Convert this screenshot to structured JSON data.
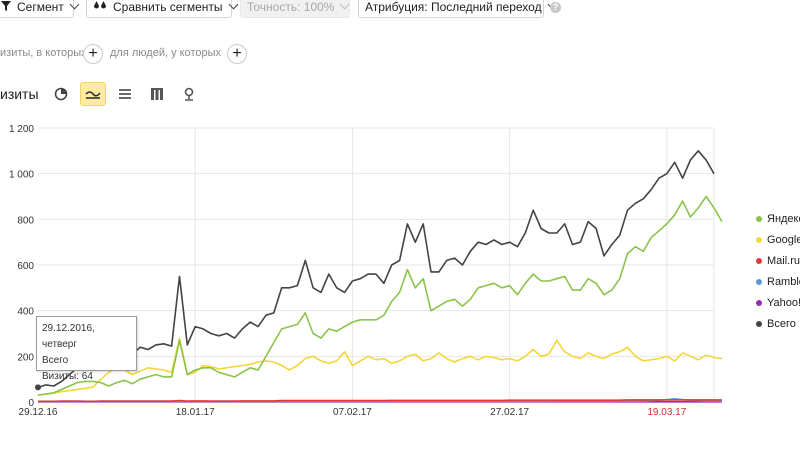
{
  "toolbar": {
    "segment_label": "Сегмент",
    "compare_label": "Сравнить сегменты",
    "accuracy_label": "Точность: 100%",
    "attribution_label": "Атрибуция: Последний переход",
    "help_glyph": "?"
  },
  "filters": {
    "visits_label": "изиты, в которых",
    "people_label": "для людей, у которых"
  },
  "metric_label": "изиты",
  "legend": [
    {
      "label": "Яндекс",
      "color": "#8bc34a"
    },
    {
      "label": "Google",
      "color": "#f5d63b"
    },
    {
      "label": "Mail.ru",
      "color": "#e53935"
    },
    {
      "label": "Rambler",
      "color": "#5b9bd5"
    },
    {
      "label": "Yahoo!",
      "color": "#9c27b0"
    },
    {
      "label": "Всего",
      "color": "#444444"
    }
  ],
  "tooltip": {
    "date": "29.12.2016, четверг",
    "series": "Всего",
    "value": "Визиты: 64"
  },
  "chart_data": {
    "type": "line",
    "x_ticks": [
      "29.12.16",
      "18.01.17",
      "07.02.17",
      "27.02.17",
      "19.03.17"
    ],
    "x_tick_highlight": "19.03.17",
    "y_ticks": [
      "0",
      "200",
      "400",
      "600",
      "800",
      "1 000",
      "1 200"
    ],
    "ylim": [
      0,
      1200
    ],
    "x_start": "2016-12-29",
    "series": [
      {
        "name": "Всего",
        "color": "#444444",
        "values": [
          64,
          75,
          70,
          90,
          120,
          150,
          180,
          200,
          230,
          210,
          220,
          250,
          210,
          240,
          230,
          250,
          255,
          245,
          550,
          250,
          330,
          320,
          300,
          290,
          300,
          280,
          320,
          350,
          330,
          380,
          390,
          500,
          500,
          510,
          620,
          500,
          480,
          560,
          500,
          480,
          530,
          540,
          560,
          560,
          520,
          600,
          620,
          780,
          700,
          780,
          570,
          570,
          620,
          630,
          600,
          660,
          700,
          690,
          710,
          690,
          700,
          680,
          740,
          840,
          760,
          740,
          740,
          780,
          690,
          700,
          790,
          760,
          640,
          690,
          730,
          840,
          870,
          890,
          930,
          980,
          1000,
          1050,
          980,
          1060,
          1100,
          1060,
          1000
        ]
      },
      {
        "name": "Яндекс",
        "color": "#8bc34a",
        "values": [
          30,
          35,
          40,
          55,
          70,
          85,
          90,
          90,
          85,
          70,
          85,
          95,
          80,
          100,
          110,
          120,
          110,
          110,
          270,
          120,
          140,
          150,
          150,
          130,
          120,
          110,
          130,
          150,
          140,
          200,
          260,
          320,
          330,
          340,
          390,
          300,
          280,
          320,
          310,
          330,
          350,
          360,
          360,
          360,
          380,
          440,
          480,
          580,
          500,
          540,
          400,
          420,
          440,
          450,
          420,
          450,
          500,
          510,
          520,
          500,
          510,
          470,
          520,
          560,
          530,
          530,
          540,
          550,
          490,
          490,
          540,
          520,
          470,
          490,
          540,
          650,
          680,
          660,
          720,
          750,
          780,
          820,
          880,
          810,
          850,
          900,
          850,
          790
        ]
      },
      {
        "name": "Google",
        "color": "#f5d63b",
        "values": [
          30,
          35,
          40,
          45,
          50,
          55,
          60,
          65,
          100,
          130,
          150,
          140,
          120,
          135,
          150,
          145,
          140,
          130,
          280,
          120,
          130,
          160,
          155,
          145,
          150,
          155,
          160,
          165,
          175,
          180,
          175,
          160,
          140,
          160,
          190,
          200,
          180,
          170,
          180,
          220,
          160,
          180,
          200,
          185,
          190,
          170,
          180,
          200,
          210,
          180,
          190,
          215,
          190,
          175,
          190,
          200,
          185,
          200,
          195,
          185,
          190,
          180,
          200,
          230,
          200,
          210,
          270,
          220,
          200,
          190,
          215,
          200,
          190,
          210,
          220,
          240,
          200,
          180,
          185,
          190,
          200,
          180,
          215,
          200,
          185,
          205,
          195,
          190
        ]
      },
      {
        "name": "Mail.ru",
        "color": "#e53935",
        "values": [
          3,
          3,
          3,
          4,
          4,
          4,
          3,
          3,
          4,
          4,
          4,
          4,
          4,
          4,
          4,
          4,
          4,
          4,
          6,
          4,
          5,
          5,
          4,
          4,
          4,
          4,
          5,
          5,
          5,
          5,
          5,
          6,
          6,
          6,
          6,
          6,
          6,
          6,
          6,
          6,
          6,
          6,
          6,
          6,
          6,
          7,
          7,
          7,
          7,
          7,
          7,
          7,
          7,
          7,
          7,
          7,
          7,
          7,
          7,
          7,
          8,
          8,
          8,
          8,
          8,
          8,
          8,
          8,
          8,
          8,
          8,
          8,
          8,
          8,
          8,
          9,
          9,
          9,
          9,
          9,
          9,
          9,
          9,
          9,
          9,
          9,
          9,
          9
        ]
      },
      {
        "name": "Rambler",
        "color": "#5b9bd5",
        "values": [
          2,
          2,
          2,
          2,
          2,
          2,
          2,
          2,
          2,
          2,
          2,
          2,
          2,
          2,
          2,
          2,
          2,
          2,
          3,
          2,
          2,
          2,
          2,
          2,
          2,
          2,
          2,
          2,
          2,
          2,
          2,
          2,
          2,
          2,
          2,
          2,
          2,
          2,
          2,
          2,
          2,
          2,
          2,
          3,
          3,
          3,
          3,
          3,
          3,
          3,
          3,
          3,
          3,
          3,
          3,
          3,
          3,
          3,
          3,
          3,
          3,
          3,
          3,
          3,
          3,
          3,
          4,
          4,
          4,
          4,
          4,
          4,
          4,
          4,
          4,
          4,
          4,
          5,
          6,
          8,
          10,
          14,
          10,
          8,
          6,
          5,
          5,
          5
        ]
      },
      {
        "name": "Yahoo!",
        "color": "#9c27b0",
        "values": [
          1,
          1,
          1,
          1,
          1,
          1,
          1,
          1,
          1,
          1,
          1,
          1,
          1,
          1,
          1,
          1,
          1,
          1,
          1,
          1,
          1,
          1,
          1,
          1,
          1,
          1,
          1,
          1,
          1,
          1,
          1,
          1,
          1,
          1,
          1,
          1,
          1,
          1,
          1,
          1,
          1,
          1,
          1,
          1,
          1,
          1,
          1,
          1,
          1,
          1,
          1,
          1,
          1,
          1,
          1,
          1,
          1,
          1,
          1,
          1,
          1,
          1,
          1,
          1,
          1,
          1,
          1,
          1,
          1,
          1,
          1,
          1,
          1,
          1,
          1,
          1,
          1,
          1,
          1,
          1,
          1,
          1,
          1,
          1,
          1,
          1,
          1,
          1
        ]
      }
    ],
    "grid": true,
    "legend_position": "right"
  }
}
